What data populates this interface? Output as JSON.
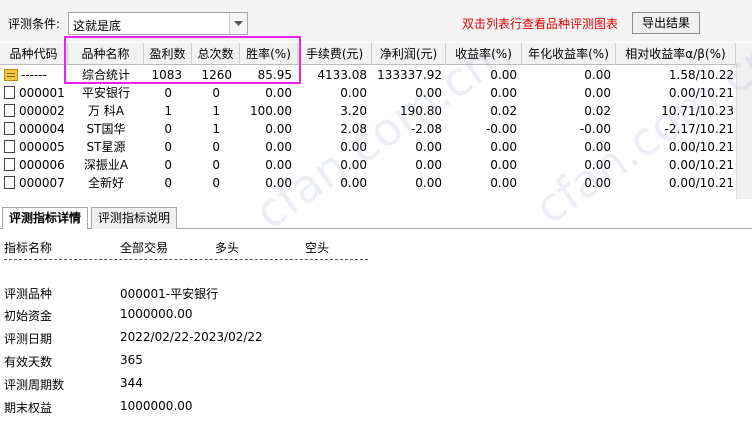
{
  "toolbar": {
    "condition_label": "评测条件:",
    "condition_value": "这就是底",
    "hint": "双击列表行查看品种评测图表",
    "export_label": "导出结果"
  },
  "grid": {
    "columns": [
      "品种代码",
      "品种名称",
      "盈利数",
      "总次数",
      "胜率(%)",
      "手续费(元)",
      "净利润(元)",
      "收益率(%)",
      "年化收益率(%)",
      "相对收益率α/β(%)"
    ],
    "rows": [
      {
        "code": "------",
        "name": "综合统计",
        "profit_count": "1083",
        "total_count": "1260",
        "win_rate": "85.95",
        "fee": "4133.08",
        "net_profit": "133337.92",
        "return": "0.00",
        "annual_return": "0.00",
        "relative": "1.58/10.22"
      },
      {
        "code": "000001",
        "name": "平安银行",
        "profit_count": "0",
        "total_count": "0",
        "win_rate": "0.00",
        "fee": "0.00",
        "net_profit": "0.00",
        "return": "0.00",
        "annual_return": "0.00",
        "relative": "0.00/10.21"
      },
      {
        "code": "000002",
        "name": "万 科A",
        "profit_count": "1",
        "total_count": "1",
        "win_rate": "100.00",
        "fee": "3.20",
        "net_profit": "190.80",
        "return": "0.02",
        "annual_return": "0.02",
        "relative": "10.71/10.23"
      },
      {
        "code": "000004",
        "name": "ST国华",
        "profit_count": "0",
        "total_count": "1",
        "win_rate": "0.00",
        "fee": "2.08",
        "net_profit": "-2.08",
        "return": "-0.00",
        "annual_return": "-0.00",
        "relative": "-2.17/10.21"
      },
      {
        "code": "000005",
        "name": "ST星源",
        "profit_count": "0",
        "total_count": "0",
        "win_rate": "0.00",
        "fee": "0.00",
        "net_profit": "0.00",
        "return": "0.00",
        "annual_return": "0.00",
        "relative": "0.00/10.21"
      },
      {
        "code": "000006",
        "name": "深振业A",
        "profit_count": "0",
        "total_count": "0",
        "win_rate": "0.00",
        "fee": "0.00",
        "net_profit": "0.00",
        "return": "0.00",
        "annual_return": "0.00",
        "relative": "0.00/10.21"
      },
      {
        "code": "000007",
        "name": "全新好",
        "profit_count": "0",
        "total_count": "0",
        "win_rate": "0.00",
        "fee": "0.00",
        "net_profit": "0.00",
        "return": "0.00",
        "annual_return": "0.00",
        "relative": "0.00/10.21"
      }
    ]
  },
  "tabs": [
    "评测指标详情",
    "评测指标说明"
  ],
  "detail": {
    "header": {
      "name": "指标名称",
      "all": "全部交易",
      "long": "多头",
      "short": "空头"
    },
    "rows": [
      {
        "label": "评测品种",
        "value": "000001-平安银行"
      },
      {
        "label": "初始资金",
        "value": "1000000.00"
      },
      {
        "label": "评测日期",
        "value": "2022/02/22-2023/02/22"
      },
      {
        "label": "有效天数",
        "value": "365"
      },
      {
        "label": "评测周期数",
        "value": " 344"
      },
      {
        "label": "期末权益",
        "value": "1000000.00"
      }
    ]
  },
  "watermark": "cfan.com.cn",
  "colors": {
    "hint": "#e00000",
    "highlight": "#ee22ee",
    "icon": "#f5c842"
  }
}
